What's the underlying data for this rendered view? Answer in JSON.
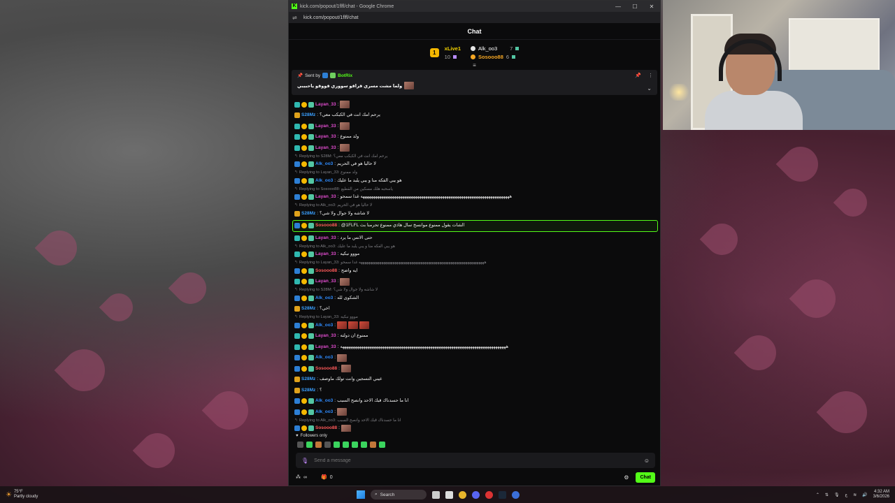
{
  "window": {
    "title": "kick.com/popout/1flfl/chat - Google Chrome",
    "url": "kick.com/popout/1flfl/chat",
    "controls": [
      "—",
      "☐",
      "✕"
    ]
  },
  "chat": {
    "header": "Chat",
    "leaderboard": {
      "rank": "1",
      "first": {
        "name": "xLive1",
        "count": "10"
      },
      "second": {
        "name": "Alk_oo3",
        "count": "7"
      },
      "third": {
        "name": "Sosooo88",
        "count": "6"
      }
    },
    "pinned": {
      "sent_by_label": "Sent by",
      "sender": "BotRix",
      "message": "ولما مشت مسري قراقو سووري قووقو ياحبيبي"
    },
    "messages": [
      {
        "reply": "",
        "badges": [
          "sub",
          "gift",
          "vip"
        ],
        "user": "Layan_33",
        "color": "pink",
        "text": "",
        "emotes": 1
      },
      {
        "reply": "",
        "badges": [
          "crown"
        ],
        "user": "S28Mz",
        "color": "cyan",
        "text": "يرحم امك انت في الكبكب معي؟",
        "emotes": 0
      },
      {
        "reply": "",
        "badges": [
          "sub",
          "gift",
          "vip"
        ],
        "user": "Layan_33",
        "color": "pink",
        "text": "",
        "emotes": 1
      },
      {
        "reply": "",
        "badges": [
          "sub",
          "gift",
          "vip"
        ],
        "user": "Layan_33",
        "color": "pink",
        "text": "ولد ممنوع",
        "emotes": 0
      },
      {
        "reply": "",
        "badges": [
          "sub",
          "gift",
          "vip"
        ],
        "user": "Layan_33",
        "color": "pink",
        "text": "",
        "emotes": 1
      },
      {
        "reply": "Replying to S28M: يرحم امك انت في الكبكب معي؟",
        "badges": [
          "ship",
          "gift",
          "vip"
        ],
        "user": "Alk_oo3",
        "color": "blue",
        "text": "لا حاليا هو في الحريم",
        "emotes": 0
      },
      {
        "reply": "Replying to Layan_33: ولد ممنوع",
        "badges": [
          "ship",
          "gift",
          "vip"
        ],
        "user": "Alk_oo3",
        "color": "blue",
        "text": "هو يبي الفكه منا و يبي يلبد ما عليك",
        "emotes": 0
      },
      {
        "reply": "Replying to Sosooo88: ياسحبه هلك مسكين من القطيع",
        "badges": [
          "ship",
          "gift",
          "vip"
        ],
        "user": "Layan_33",
        "color": "pink",
        "text": "هههههههههههههههههههههههههههههههههههههههههههههههههههههههههههههههههههههههه غدا سمحو",
        "emotes": 0
      },
      {
        "reply": "Replying to Alk_oo3: لا حاليا هو في الحريم",
        "badges": [
          "crown"
        ],
        "user": "S28Mz",
        "color": "cyan",
        "text": "لا شاشه ولا جوال ولا شي؟",
        "emotes": 0
      },
      {
        "reply": "",
        "badges": [
          "ship",
          "gift",
          "vip"
        ],
        "user": "Sosooo88",
        "color": "red",
        "text": "@1FLFL الشات يقول ممنوع موانسخ سال هاذي ممنوع تحرمنا بث",
        "emotes": 0,
        "highlight": true
      },
      {
        "reply": "",
        "badges": [
          "sub",
          "gift",
          "vip"
        ],
        "user": "Layan_33",
        "color": "pink",
        "text": "حتى الانس ما يرد",
        "emotes": 0
      },
      {
        "reply": "Replying to Alk_oo3: هو يبي الفكه منا و يبي يلبد ما عليك",
        "badges": [
          "sub",
          "gift",
          "vip"
        ],
        "user": "Layan_33",
        "color": "pink",
        "text": "مووو نبكيه",
        "emotes": 0
      },
      {
        "reply": "Replying to Layan_33: هههههههههههههههههههههههههههههههههههههههههههههههههههههههههههههههههههه غدا سمحو",
        "badges": [
          "ship",
          "gift",
          "vip"
        ],
        "user": "Sosooo88",
        "color": "red",
        "text": "ايه واضح",
        "emotes": 0
      },
      {
        "reply": "",
        "badges": [
          "sub",
          "gift",
          "vip"
        ],
        "user": "Layan_33",
        "color": "pink",
        "text": "",
        "emotes": 1
      },
      {
        "reply": "Replying to S28M: لا شاشه ولا جوال ولا شي؟",
        "badges": [
          "ship",
          "gift",
          "vip"
        ],
        "user": "Alk_oo3",
        "color": "blue",
        "text": "الشكوى لله",
        "emotes": 0
      },
      {
        "reply": "",
        "badges": [
          "crown"
        ],
        "user": "S28Mz",
        "color": "cyan",
        "text": "اخي؟",
        "emotes": 0
      },
      {
        "reply": "Replying to Layan_33: مووو نبكيه",
        "badges": [
          "ship",
          "gift",
          "vip"
        ],
        "user": "Alk_oo3",
        "color": "blue",
        "text": "",
        "emotes": 3
      },
      {
        "reply": "",
        "badges": [
          "sub",
          "gift",
          "vip"
        ],
        "user": "Layan_33",
        "color": "pink",
        "text": "ممنوع ان دولته",
        "emotes": 0
      },
      {
        "reply": "",
        "badges": [
          "sub",
          "gift",
          "vip"
        ],
        "user": "Layan_33",
        "color": "pink",
        "text": "هههههههههههههههههههههههههههههههههههههههههههههههههههههههههههههههههههههههههههههههه",
        "emotes": 0
      },
      {
        "reply": "",
        "badges": [
          "ship",
          "gift",
          "vip"
        ],
        "user": "Alk_oo3",
        "color": "blue",
        "text": "",
        "emotes": 1
      },
      {
        "reply": "",
        "badges": [
          "ship",
          "gift",
          "vip"
        ],
        "user": "Sosooo88",
        "color": "red",
        "text": "",
        "emotes": 1
      },
      {
        "reply": "",
        "badges": [
          "crown"
        ],
        "user": "S28Mz",
        "color": "cyan",
        "text": "عيني التسجين وانت تولك ماوصف",
        "emotes": 0
      },
      {
        "reply": "",
        "badges": [
          "crown"
        ],
        "user": "S28Mz",
        "color": "cyan",
        "text": "؟",
        "emotes": 0
      },
      {
        "reply": "",
        "badges": [
          "ship",
          "gift",
          "vip"
        ],
        "user": "Alk_oo3",
        "color": "blue",
        "text": "انا ما حسدناك قبك الاحد وانصح السبب",
        "emotes": 0
      },
      {
        "reply": "",
        "badges": [
          "ship",
          "gift",
          "vip"
        ],
        "user": "Alk_oo3",
        "color": "blue",
        "text": "",
        "emotes": 1
      },
      {
        "reply": "Replying to Alk_oo3: انا ما حسدناك قبك الاحد وانصح السبب",
        "badges": [
          "ship",
          "gift",
          "vip"
        ],
        "user": "Sosooo88",
        "color": "red",
        "text": "",
        "emotes": 1
      }
    ],
    "followers_only": "Followers only",
    "input_placeholder": "Send a message",
    "footer": {
      "infinity": "∞",
      "count": "0",
      "send_label": "Chat"
    }
  },
  "taskbar": {
    "temp": "75°F",
    "weather": "Partly cloudy",
    "search": "Search",
    "time": "4:32 AM",
    "date": "3/6/2026",
    "lang": "ع"
  },
  "colors": {
    "accent": "#53fc18",
    "gold": "#f5b800"
  }
}
